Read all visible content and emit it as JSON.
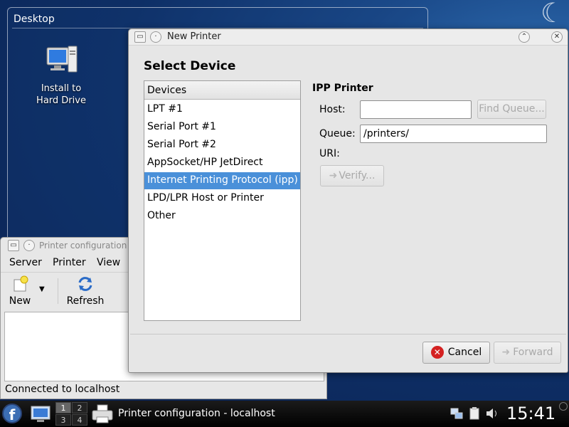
{
  "desktop": {
    "folder_view_title": "Desktop",
    "icons": [
      {
        "label_line1": "Install to",
        "label_line2": "Hard Drive",
        "icon": "computer-icon"
      }
    ]
  },
  "printer_config": {
    "title": "Printer configuration",
    "menu": [
      "Server",
      "Printer",
      "View"
    ],
    "toolbar": {
      "new_label": "New",
      "refresh_label": "Refresh"
    },
    "status": "Connected to localhost"
  },
  "dialog": {
    "title": "New Printer",
    "heading": "Select Device",
    "devices_header": "Devices",
    "devices": [
      "LPT #1",
      "Serial Port #1",
      "Serial Port #2",
      "AppSocket/HP JetDirect",
      "Internet Printing Protocol (ipp)",
      "LPD/LPR Host or Printer",
      "Other"
    ],
    "selected_device_index": 4,
    "ipp": {
      "title": "IPP Printer",
      "host_label": "Host:",
      "host_value": "",
      "find_queue_label": "Find Queue...",
      "queue_label": "Queue:",
      "queue_value": "/printers/",
      "uri_label": "URI:",
      "verify_label": "Verify..."
    },
    "buttons": {
      "cancel": "Cancel",
      "forward": "Forward"
    }
  },
  "taskbar": {
    "pager": [
      "1",
      "2",
      "3",
      "4"
    ],
    "active_desktop": "1",
    "task_label": "Printer configuration - localhost",
    "clock": "15:41"
  },
  "colors": {
    "selection": "#4a90d9",
    "desktop_bg": "#0e2f66"
  }
}
